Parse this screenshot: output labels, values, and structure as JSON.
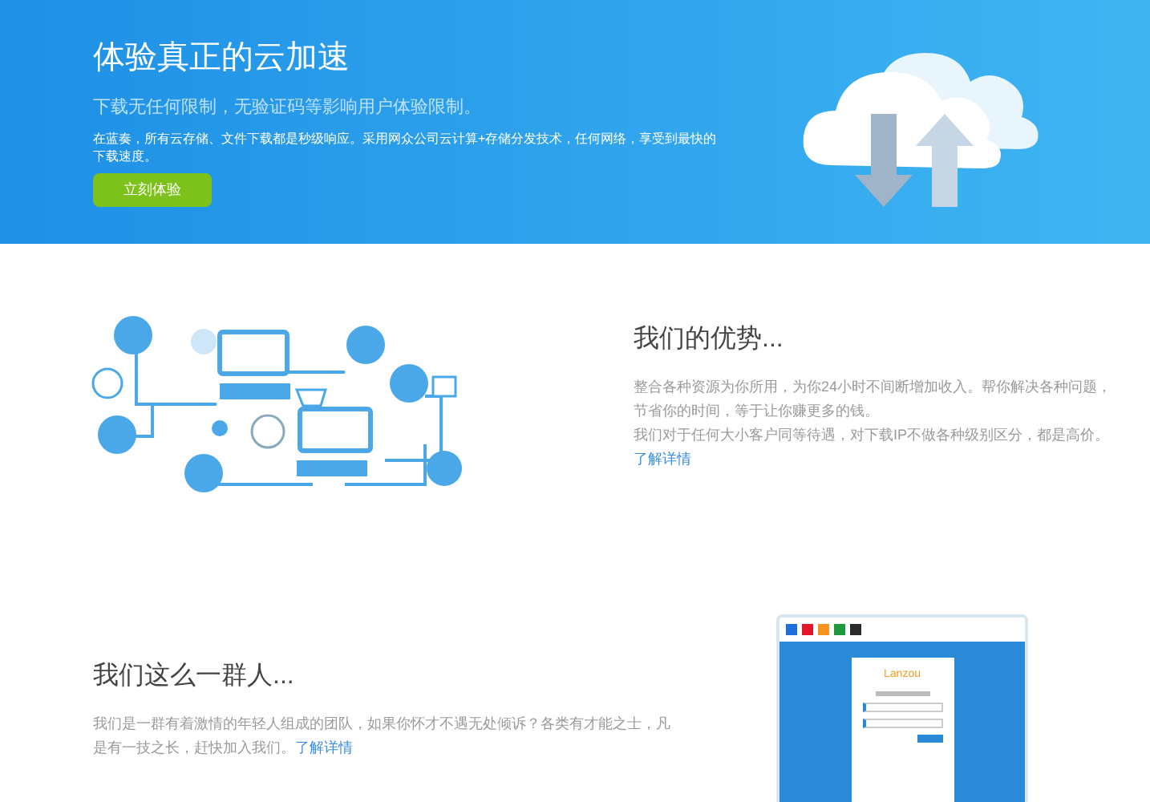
{
  "hero": {
    "title": "体验真正的云加速",
    "subtitle": "下载无任何限制，无验证码等影响用户体验限制。",
    "description": "在蓝奏，所有云存储、文件下载都是秒级响应。采用网众公司云计算+存储分发技术，任何网络，享受到最快的下载速度。",
    "button": "立刻体验"
  },
  "advantages": {
    "title": "我们的优势...",
    "paragraphs": [
      "整合各种资源为你所用，为你24小时不间断增加收入。帮你解决各种问题，节省你的时间，等于让你赚更多的钱。",
      "我们对于任何大小客户同等待遇，对下载IP不做各种级别区分，都是高价。"
    ],
    "link": "了解详情"
  },
  "team": {
    "title": "我们这么一群人...",
    "paragraph": "我们是一群有着激情的年轻人组成的团队，如果你怀才不遇无处倾诉？各类有才能之士，凡是有一技之长，赶快加入我们。",
    "link": "了解详情"
  },
  "mockup": {
    "window_dots": [
      {
        "color": "#1e6fd9"
      },
      {
        "color": "#e3162c"
      },
      {
        "color": "#f7931e"
      },
      {
        "color": "#1c9a3c"
      },
      {
        "color": "#2b2b2b"
      }
    ],
    "logo": "Lanzou"
  }
}
